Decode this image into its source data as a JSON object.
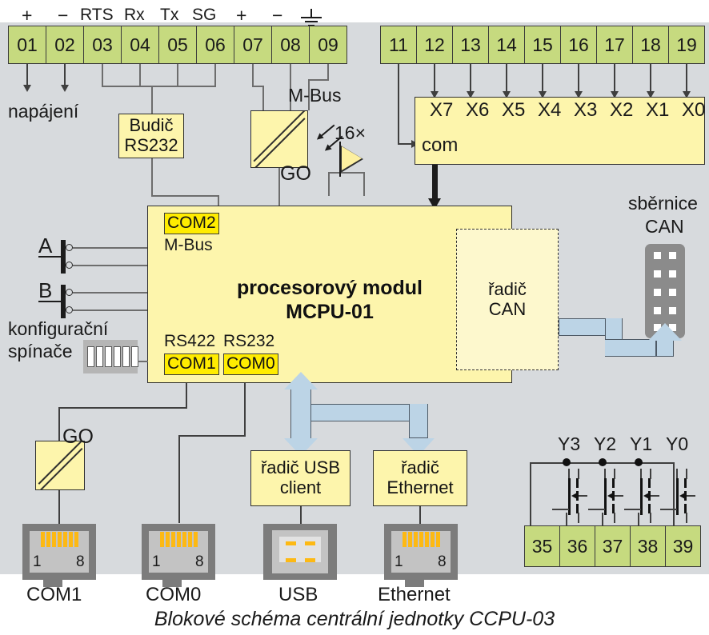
{
  "caption": "Blokové schéma centrální jednotky CCPU-03",
  "left_terminals": {
    "signals": [
      "+",
      "−",
      "RTS",
      "Rx",
      "Tx",
      "SG",
      "+",
      "−",
      "gnd"
    ],
    "numbers": [
      "01",
      "02",
      "03",
      "04",
      "05",
      "06",
      "07",
      "08",
      "09"
    ]
  },
  "right_terminals": {
    "numbers": [
      "11",
      "12",
      "13",
      "14",
      "15",
      "16",
      "17",
      "18",
      "19"
    ]
  },
  "input_block": {
    "channels": [
      "X7",
      "X6",
      "X5",
      "X4",
      "X3",
      "X2",
      "X1",
      "X0"
    ],
    "common": "com"
  },
  "output_block": {
    "channels": [
      "Y3",
      "Y2",
      "Y1",
      "Y0"
    ],
    "numbers": [
      "35",
      "36",
      "37",
      "38",
      "39"
    ]
  },
  "labels": {
    "power": "napájení",
    "mbus": "M-Bus",
    "go_top": "GO",
    "go_bottom": "GO",
    "led_count": "16×",
    "can_bus_1": "sběrnice",
    "can_bus_2": "CAN",
    "config_1": "konfigurační",
    "config_2": "spínače",
    "button_a": "A",
    "button_b": "B"
  },
  "blocks": {
    "driver": {
      "line1": "Budič",
      "line2": "RS232"
    },
    "cpu": {
      "com2_tag": "COM2",
      "com2_sub": "M-Bus",
      "title1": "procesorový modul",
      "title2": "MCPU-01",
      "rs422_label": "RS422",
      "rs232_label": "RS232",
      "com1_tag": "COM1",
      "com0_tag": "COM0"
    },
    "can_ctrl": {
      "line1": "řadič",
      "line2": "CAN"
    },
    "usb_ctrl": {
      "line1": "řadič USB",
      "line2": "client"
    },
    "eth_ctrl": {
      "line1": "řadič",
      "line2": "Ethernet"
    }
  },
  "connectors": {
    "com1": {
      "name": "COM1",
      "pin_first": "1",
      "pin_last": "8"
    },
    "com0": {
      "name": "COM0",
      "pin_first": "1",
      "pin_last": "8"
    },
    "usb": {
      "name": "USB"
    },
    "eth": {
      "name": "Ethernet",
      "pin_first": "1",
      "pin_last": "8"
    }
  },
  "colors": {
    "terminal_green": "#c6da7f",
    "block_yellow": "#fdf5ac",
    "highlight_yellow": "#ffec00",
    "bus_blue": "#bcd4e6",
    "field_grey": "#d7dadd",
    "connector_grey": "#7c7c7c",
    "pin_gold": "#fdb913"
  }
}
